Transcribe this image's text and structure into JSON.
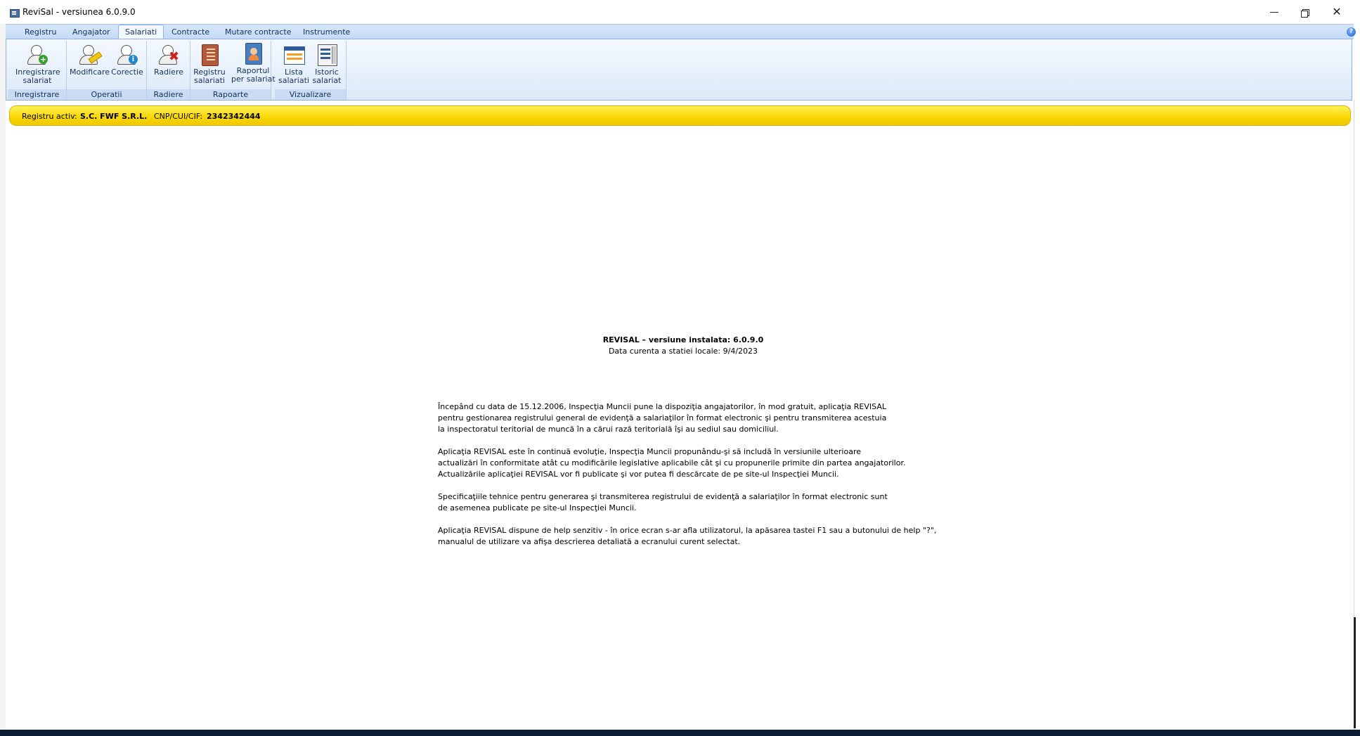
{
  "window": {
    "title": "ReviSal - versiunea 6.0.9.0",
    "controls": {
      "minimize": "minimize-icon",
      "restore": "restore-icon",
      "close": "close-icon"
    }
  },
  "ribbon": {
    "tabs": [
      "Registru",
      "Angajator",
      "Salariati",
      "Contracte",
      "Mutare contracte",
      "Instrumente"
    ],
    "active_tab": "Salariati",
    "help": "?",
    "groups": [
      {
        "label": "Inregistrare",
        "buttons": [
          {
            "line1": "Inregistrare",
            "line2": "salariat",
            "icon": "add-user-icon"
          }
        ]
      },
      {
        "label": "Operatii",
        "buttons": [
          {
            "line1": "Modificare",
            "line2": "",
            "icon": "edit-user-icon"
          },
          {
            "line1": "Corectie",
            "line2": "",
            "icon": "info-user-icon"
          }
        ]
      },
      {
        "label": "Radiere",
        "buttons": [
          {
            "line1": "Radiere",
            "line2": "",
            "icon": "remove-user-icon"
          }
        ]
      },
      {
        "label": "Rapoarte",
        "buttons": [
          {
            "line1": "Registru",
            "line2": "salariati",
            "icon": "register-book-icon"
          },
          {
            "line1": "Raportul",
            "line2": "per salariat",
            "icon": "employee-report-icon"
          }
        ]
      },
      {
        "label": "Vizualizare",
        "buttons": [
          {
            "line1": "Lista",
            "line2": "salariati",
            "icon": "list-window-icon"
          },
          {
            "line1": "Istoric",
            "line2": "salariat",
            "icon": "history-icon"
          }
        ]
      }
    ]
  },
  "active_registry": {
    "label": "Registru activ:",
    "company": "S.C. FWF S.R.L.",
    "id_label": "CNP/CUI/CIF:",
    "id_value": "2342342444"
  },
  "main": {
    "version_title": "REVISAL – versiune instalata: 6.0.9.0",
    "version_date": "Data curenta a statiei locale: 9/4/2023",
    "paragraphs": [
      [
        "Începând cu data de 15.12.2006, Inspecţia Muncii pune la dispoziţia angajatorilor, în mod gratuit, aplicaţia REVISAL",
        "pentru gestionarea registrului general de evidenţă a salariaţilor în format electronic şi pentru transmiterea acestuia",
        "la inspectoratul teritorial de muncă în a cărui rază teritorială îşi au sediul sau domiciliul."
      ],
      [
        "Aplicaţia REVISAL este în continuă evoluţie, Inspecţia Muncii propunându-şi să includă în versiunile ulterioare",
        "actualizări în conformitate atât cu modificările legislative aplicabile cât şi cu propunerile primite din partea angajatorilor.",
        "Actualizările aplicaţiei REVISAL vor fi publicate şi vor putea fi descărcate de pe site-ul Inspecţiei Muncii."
      ],
      [
        "Specificaţiile tehnice pentru generarea şi transmiterea registrului de evidenţă a salariaţilor în format electronic sunt",
        "de asemenea publicate pe site-ul Inspecţiei Muncii."
      ],
      [
        "Aplicaţia REVISAL dispune de help senzitiv - în orice ecran s-ar afla utilizatorul, la apăsarea tastei F1 sau a butonului de help \"?\",",
        "manualul de utilizare va afişa descrierea detaliată a ecranului curent selectat."
      ]
    ]
  }
}
